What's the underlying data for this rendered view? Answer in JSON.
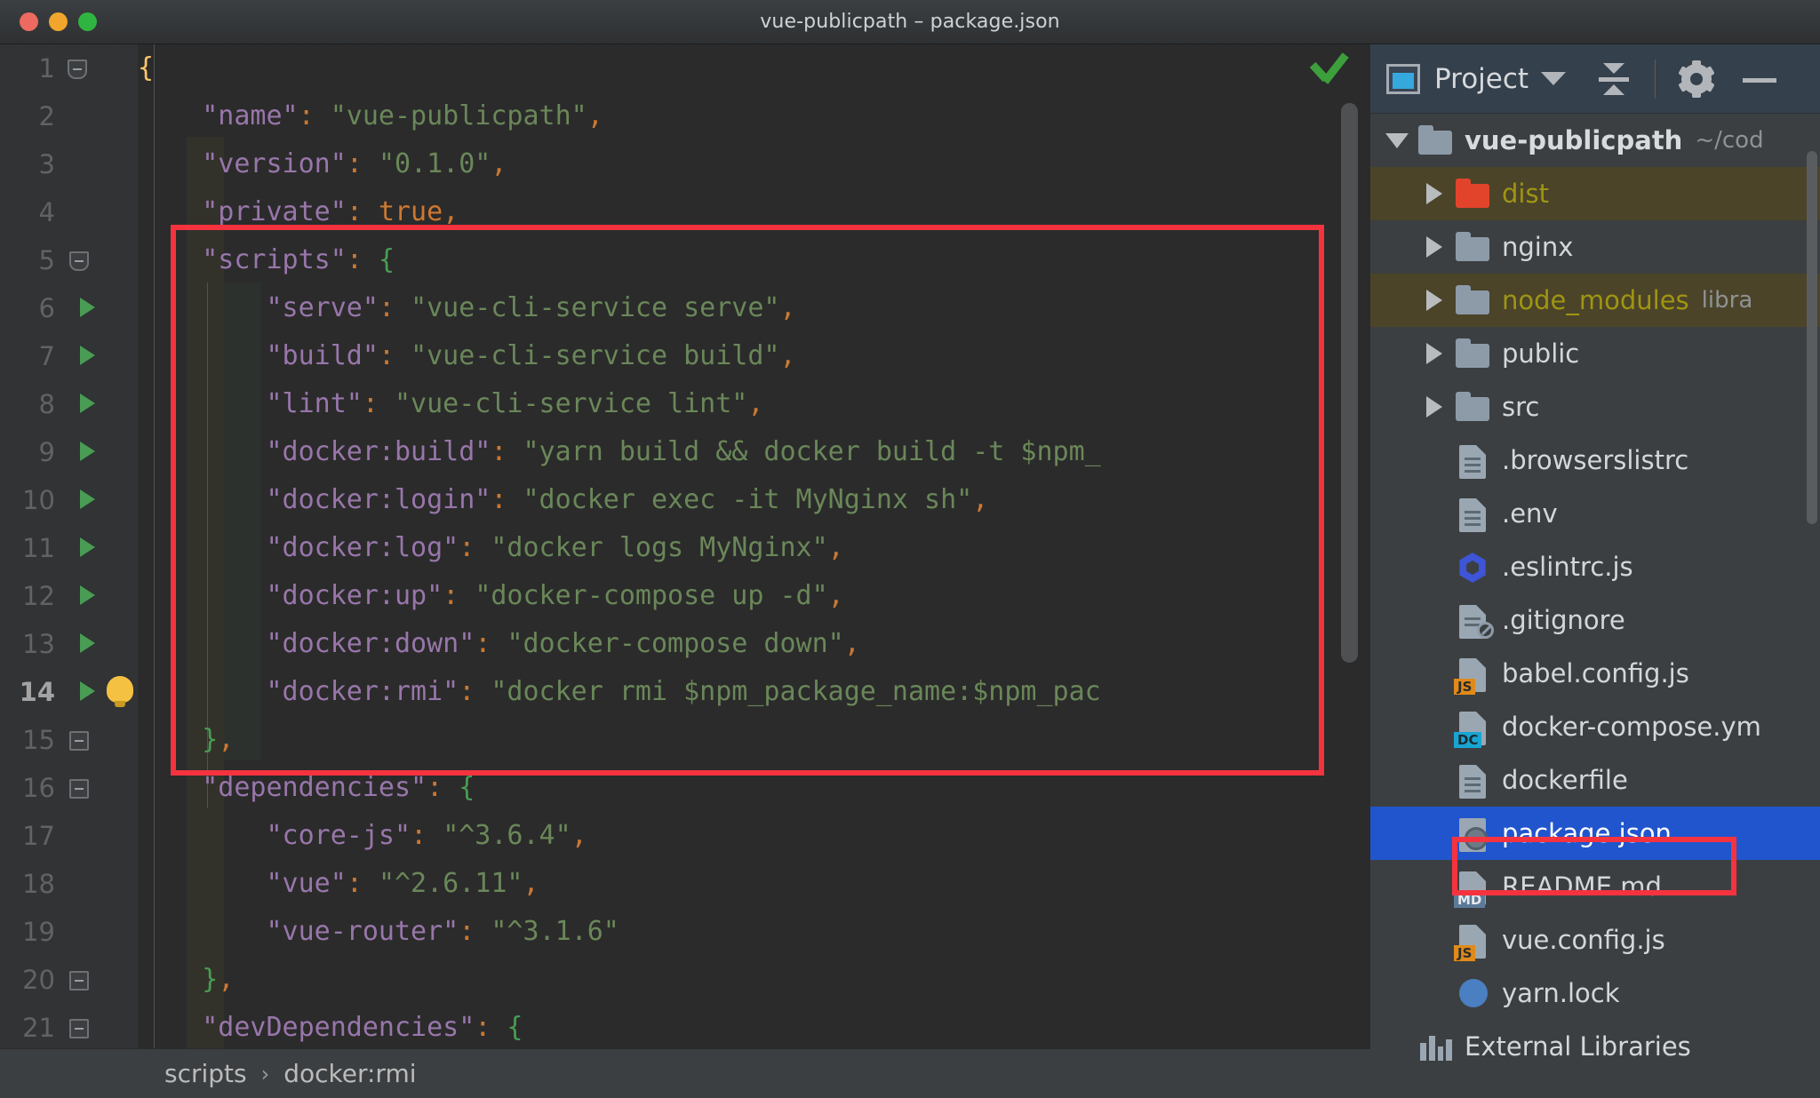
{
  "window": {
    "title": "vue-publicpath – package.json",
    "traffic_lights": [
      "close-red",
      "minimize-yellow",
      "zoom-green"
    ]
  },
  "editor": {
    "filename": "package.json",
    "inspection_status": "ok-check",
    "lines": [
      {
        "num": "1",
        "indent": 0,
        "marker": "fold",
        "text": "{"
      },
      {
        "num": "2",
        "indent": 1,
        "marker": "",
        "text": "\"name\": \"vue-publicpath\","
      },
      {
        "num": "3",
        "indent": 1,
        "marker": "",
        "text": "\"version\": \"0.1.0\","
      },
      {
        "num": "4",
        "indent": 1,
        "marker": "",
        "text": "\"private\": true,"
      },
      {
        "num": "5",
        "indent": 1,
        "marker": "fold",
        "text": "\"scripts\": {"
      },
      {
        "num": "6",
        "indent": 2,
        "marker": "run",
        "text": "\"serve\": \"vue-cli-service serve\","
      },
      {
        "num": "7",
        "indent": 2,
        "marker": "run",
        "text": "\"build\": \"vue-cli-service build\","
      },
      {
        "num": "8",
        "indent": 2,
        "marker": "run",
        "text": "\"lint\": \"vue-cli-service lint\","
      },
      {
        "num": "9",
        "indent": 2,
        "marker": "run",
        "text": "\"docker:build\": \"yarn build && docker build -t $npm_"
      },
      {
        "num": "10",
        "indent": 2,
        "marker": "run",
        "text": "\"docker:login\": \"docker exec -it MyNginx sh\","
      },
      {
        "num": "11",
        "indent": 2,
        "marker": "run",
        "text": "\"docker:log\": \"docker logs MyNginx\","
      },
      {
        "num": "12",
        "indent": 2,
        "marker": "run",
        "text": "\"docker:up\": \"docker-compose up -d\","
      },
      {
        "num": "13",
        "indent": 2,
        "marker": "run",
        "text": "\"docker:down\": \"docker-compose down\","
      },
      {
        "num": "14",
        "indent": 2,
        "marker": "run-bulb",
        "text": "\"docker:rmi\": \"docker rmi $npm_package_name:$npm_pac"
      },
      {
        "num": "15",
        "indent": 1,
        "marker": "fold",
        "text": "},"
      },
      {
        "num": "16",
        "indent": 1,
        "marker": "fold",
        "text": "\"dependencies\": {"
      },
      {
        "num": "17",
        "indent": 2,
        "marker": "",
        "text": "\"core-js\": \"^3.6.4\","
      },
      {
        "num": "18",
        "indent": 2,
        "marker": "",
        "text": "\"vue\": \"^2.6.11\","
      },
      {
        "num": "19",
        "indent": 2,
        "marker": "",
        "text": "\"vue-router\": \"^3.1.6\""
      },
      {
        "num": "20",
        "indent": 1,
        "marker": "fold",
        "text": "},"
      },
      {
        "num": "21",
        "indent": 1,
        "marker": "fold",
        "text": "\"devDependencies\": {"
      }
    ],
    "current_line": "14"
  },
  "breadcrumb": {
    "items": [
      "scripts",
      "docker:rmi"
    ],
    "separator": "›"
  },
  "project_panel": {
    "title": "Project",
    "icons": [
      "project-icon",
      "chevron-down-icon",
      "collapse-all-icon",
      "gear-icon",
      "minimize-icon"
    ],
    "tree": [
      {
        "label": "vue-publicpath",
        "hint": "~/cod",
        "icon": "folder",
        "twisty": "down",
        "kind": "root",
        "indent": 0
      },
      {
        "label": "dist",
        "hint": "",
        "icon": "folder-red",
        "twisty": "right",
        "kind": "ignored",
        "indent": 1
      },
      {
        "label": "nginx",
        "hint": "",
        "icon": "folder",
        "twisty": "right",
        "kind": "normal",
        "indent": 1
      },
      {
        "label": "node_modules",
        "hint": "libra",
        "icon": "folder",
        "twisty": "right",
        "kind": "ignored",
        "indent": 1
      },
      {
        "label": "public",
        "hint": "",
        "icon": "folder",
        "twisty": "right",
        "kind": "normal",
        "indent": 1
      },
      {
        "label": "src",
        "hint": "",
        "icon": "folder",
        "twisty": "right",
        "kind": "normal",
        "indent": 1
      },
      {
        "label": ".browserslistrc",
        "hint": "",
        "icon": "file",
        "twisty": "",
        "kind": "normal",
        "indent": 1
      },
      {
        "label": ".env",
        "hint": "",
        "icon": "file",
        "twisty": "",
        "kind": "normal",
        "indent": 1
      },
      {
        "label": ".eslintrc.js",
        "hint": "",
        "icon": "eslint",
        "twisty": "",
        "kind": "normal",
        "indent": 1
      },
      {
        "label": ".gitignore",
        "hint": "",
        "icon": "gitignore",
        "twisty": "",
        "kind": "normal",
        "indent": 1
      },
      {
        "label": "babel.config.js",
        "hint": "",
        "icon": "file-js",
        "twisty": "",
        "kind": "normal",
        "indent": 1
      },
      {
        "label": "docker-compose.ym",
        "hint": "",
        "icon": "file-dc",
        "twisty": "",
        "kind": "normal",
        "indent": 1
      },
      {
        "label": "dockerfile",
        "hint": "",
        "icon": "file",
        "twisty": "",
        "kind": "normal",
        "indent": 1
      },
      {
        "label": "package.json",
        "hint": "",
        "icon": "file-json",
        "twisty": "",
        "kind": "selected",
        "indent": 1
      },
      {
        "label": "README.md",
        "hint": "",
        "icon": "file-md",
        "twisty": "",
        "kind": "normal",
        "indent": 1
      },
      {
        "label": "vue.config.js",
        "hint": "",
        "icon": "file-js",
        "twisty": "",
        "kind": "normal",
        "indent": 1
      },
      {
        "label": "yarn.lock",
        "hint": "",
        "icon": "yarn",
        "twisty": "",
        "kind": "normal",
        "indent": 1
      },
      {
        "label": "External Libraries",
        "hint": "",
        "icon": "libraries",
        "twisty": "",
        "kind": "normal",
        "indent": 0
      }
    ]
  },
  "annotations": {
    "scripts_block_highlight_color": "#f5333f",
    "package_json_highlight_color": "#f5333f"
  },
  "colors": {
    "bg_editor": "#2b2b2b",
    "bg_gutter": "#313335",
    "bg_panel": "#3c3f41",
    "key": "#9876aa",
    "string": "#6a8759",
    "punct": "#cc7832",
    "brace_outer": "#ffc66d",
    "brace_inner": "#499c54",
    "selection_blue": "#2155cd",
    "ignored_yellow": "#9f9512"
  }
}
